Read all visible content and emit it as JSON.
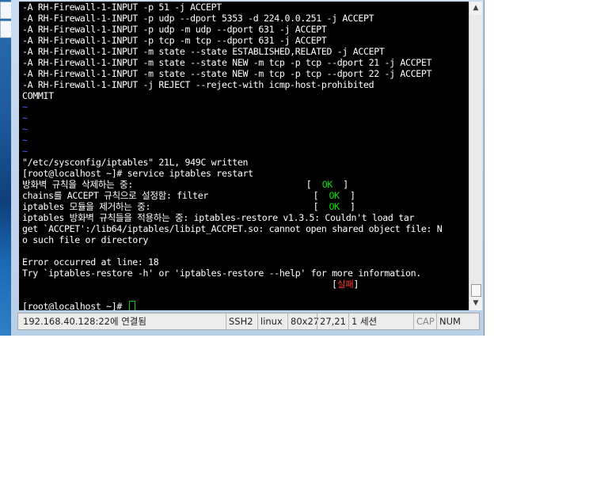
{
  "terminal": {
    "lines": [
      {
        "text": "-A RH-Firewall-1-INPUT -p 51 -j ACCEPT"
      },
      {
        "text": "-A RH-Firewall-1-INPUT -p udp --dport 5353 -d 224.0.0.251 -j ACCEPT"
      },
      {
        "text": "-A RH-Firewall-1-INPUT -p udp -m udp --dport 631 -j ACCEPT"
      },
      {
        "text": "-A RH-Firewall-1-INPUT -p tcp -m tcp --dport 631 -j ACCEPT"
      },
      {
        "text": "-A RH-Firewall-1-INPUT -m state --state ESTABLISHED,RELATED -j ACCEPT"
      },
      {
        "text": "-A RH-Firewall-1-INPUT -m state --state NEW -m tcp -p tcp --dport 21 -j ACCPET"
      },
      {
        "text": "-A RH-Firewall-1-INPUT -m state --state NEW -m tcp -p tcp --dport 22 -j ACCEPT"
      },
      {
        "text": "-A RH-Firewall-1-INPUT -j REJECT --reject-with icmp-host-prohibited"
      },
      {
        "text": "COMMIT"
      },
      {
        "text": "~",
        "kind": "tilde"
      },
      {
        "text": "~",
        "kind": "tilde"
      },
      {
        "text": "~",
        "kind": "tilde"
      },
      {
        "text": "~",
        "kind": "tilde"
      },
      {
        "text": "~",
        "kind": "tilde"
      },
      {
        "text": "\"/etc/sysconfig/iptables\" 21L, 949C written"
      },
      {
        "text": "[root@localhost ~]# service iptables restart"
      },
      {
        "text": "방화벽 규칙을 삭제하는 중:                                 [  ",
        "status": "OK",
        "tail": "  ]"
      },
      {
        "text": "chains를 ACCEPT 규칙으로 설정함: filter                    [  ",
        "status": "OK",
        "tail": "  ]"
      },
      {
        "text": "iptables 모듈을 제거하는 중:                               [  ",
        "status": "OK",
        "tail": "  ]"
      },
      {
        "text": "iptables 방화벽 규칙들을 적용하는 중: iptables-restore v1.3.5: Couldn't load tar"
      },
      {
        "text": "get `ACCPET':/lib64/iptables/libipt_ACCPET.so: cannot open shared object file: N"
      },
      {
        "text": "o such file or directory"
      },
      {
        "text": ""
      },
      {
        "text": "Error occurred at line: 18"
      },
      {
        "text": "Try `iptables-restore -h' or 'iptables-restore --help' for more information."
      },
      {
        "text": "                                                           [",
        "status": "실패",
        "status_kind": "fail",
        "tail": "]"
      },
      {
        "text": ""
      },
      {
        "text": "[root@localhost ~]# ",
        "cursor": true
      }
    ]
  },
  "scrollbar": {
    "up_icon": "▲",
    "down_icon": "▼"
  },
  "statusbar": {
    "connection": "192.168.40.128:22에 연결됨",
    "protocol": "SSH2",
    "terminal_type": "linux",
    "size": "80x27",
    "cursor_pos": "27,21",
    "sessions": "1 세션",
    "caps": "CAP",
    "num": "NUM"
  }
}
